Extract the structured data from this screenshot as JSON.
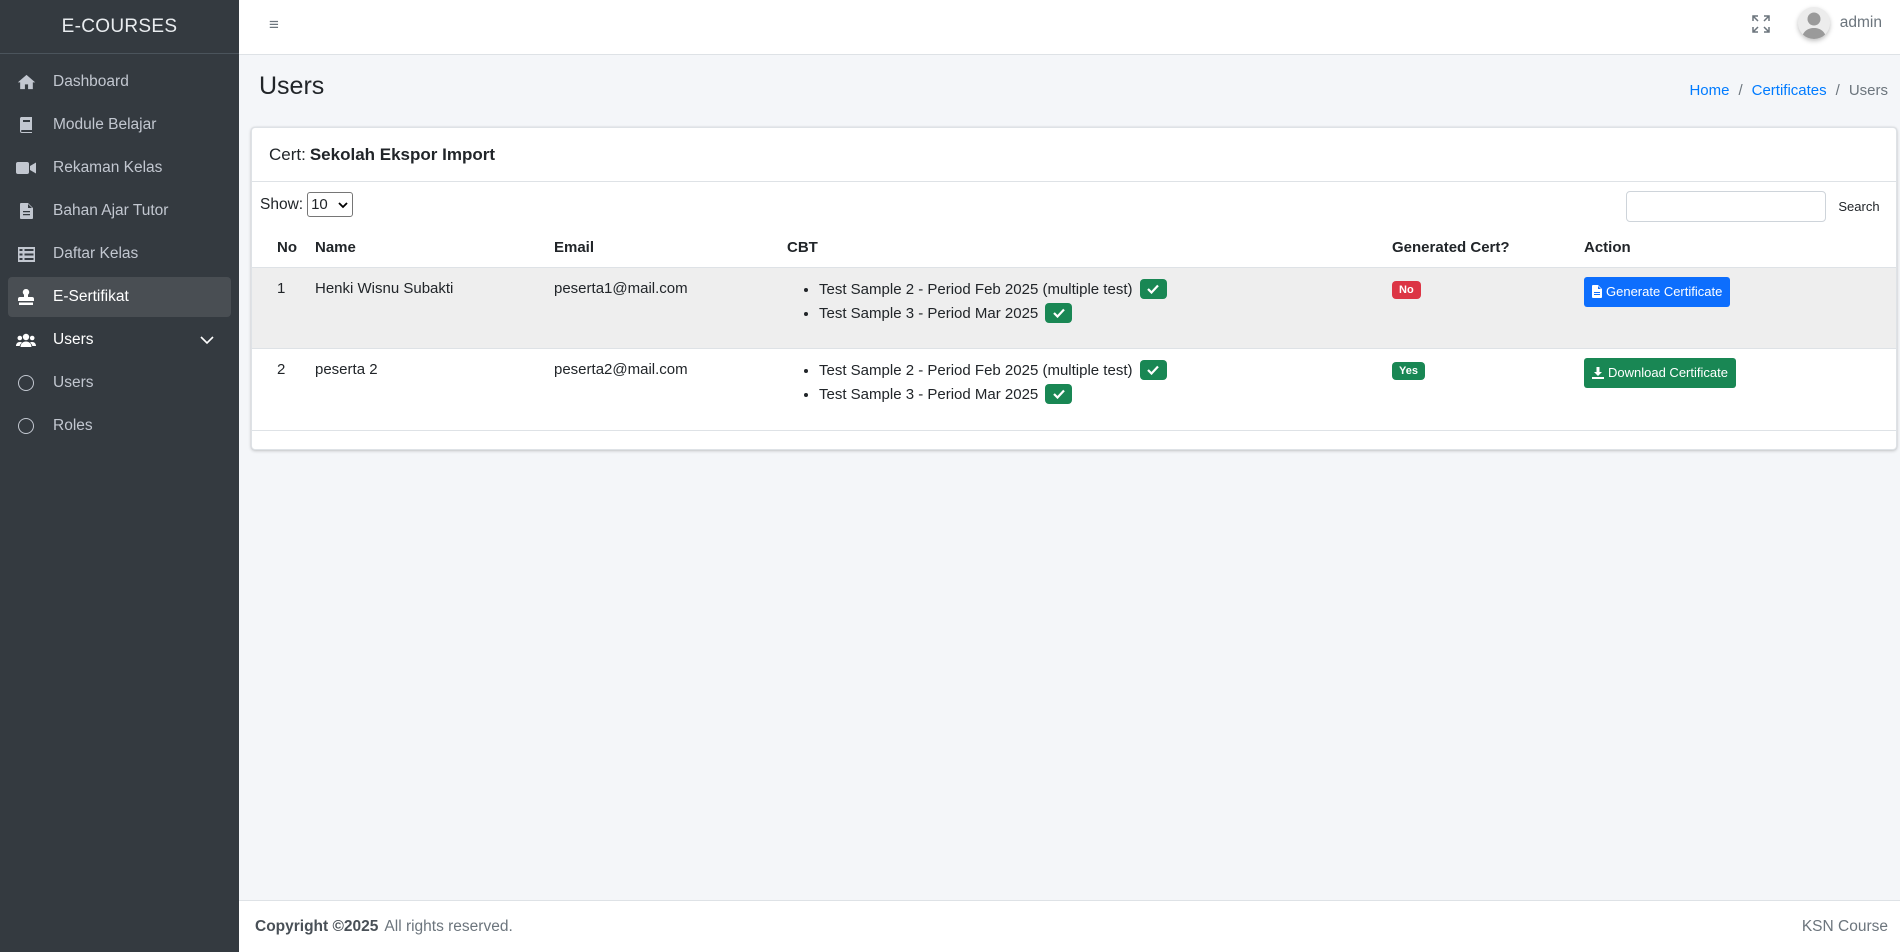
{
  "brand": "E-COURSES",
  "sidebar": {
    "items": [
      {
        "label": "Dashboard",
        "icon": "home-icon"
      },
      {
        "label": "Module Belajar",
        "icon": "book-icon"
      },
      {
        "label": "Rekaman Kelas",
        "icon": "video-icon"
      },
      {
        "label": "Bahan Ajar Tutor",
        "icon": "file-icon"
      },
      {
        "label": "Daftar Kelas",
        "icon": "list-icon"
      },
      {
        "label": "E-Sertifikat",
        "icon": "stamp-icon",
        "active": true
      },
      {
        "label": "Users",
        "icon": "users-icon",
        "expanded": true
      }
    ],
    "subitems": [
      {
        "label": "Users",
        "icon": "circle-icon"
      },
      {
        "label": "Roles",
        "icon": "circle-icon"
      }
    ]
  },
  "topbar": {
    "menu_icon": "≡",
    "user_name": "admin"
  },
  "page": {
    "title": "Users",
    "breadcrumb": {
      "home": "Home",
      "certificates": "Certificates",
      "sep": "/",
      "current": "Users"
    }
  },
  "card": {
    "cert_label": "Cert:",
    "cert_name": "Sekolah Ekspor Import",
    "show_label": "Show:",
    "show_value": "10",
    "search_value": "",
    "search_label": "Search"
  },
  "table": {
    "headers": {
      "no": "No",
      "name": "Name",
      "email": "Email",
      "cbt": "CBT",
      "generated": "Generated Cert?",
      "action": "Action"
    },
    "rows": [
      {
        "no": "1",
        "name": "Henki Wisnu Subakti",
        "email": "peserta1@mail.com",
        "cbt": [
          "Test Sample 2 - Period Feb 2025 (multiple test)",
          "Test Sample 3 - Period Mar 2025"
        ],
        "generated": "No",
        "action": "Generate Certificate"
      },
      {
        "no": "2",
        "name": "peserta 2",
        "email": "peserta2@mail.com",
        "cbt": [
          "Test Sample 2 - Period Feb 2025 (multiple test)",
          "Test Sample 3 - Period Mar 2025"
        ],
        "generated": "Yes",
        "action": "Download Certificate"
      }
    ]
  },
  "footer": {
    "copyright": "Copyright ©2025",
    "rights": "All rights reserved.",
    "right_text": "KSN Course"
  },
  "colors": {
    "sidebar_bg": "#343a40",
    "primary": "#0d6efd",
    "success": "#198754",
    "danger": "#dc3545",
    "link": "#007bff"
  }
}
